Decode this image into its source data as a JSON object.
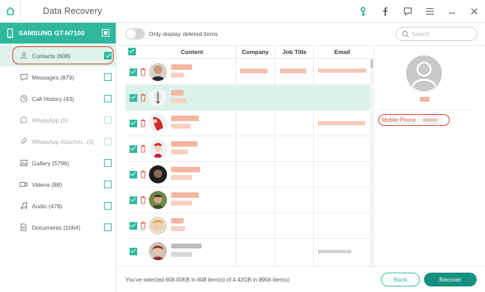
{
  "app": {
    "title": "Data Recovery"
  },
  "titlebar_icons": [
    "key-icon",
    "facebook-icon",
    "feedback-icon",
    "menu-icon",
    "minimize-icon",
    "close-icon"
  ],
  "device": {
    "name": "SAMSUNG GT-N7100"
  },
  "sidebar": {
    "items": [
      {
        "label": "Contacts (608)",
        "icon": "contact-icon",
        "active": true,
        "checked": true
      },
      {
        "label": "Messages (879)",
        "icon": "message-icon"
      },
      {
        "label": "Call History (43)",
        "icon": "clock-icon"
      },
      {
        "label": "WhatsApp (0)",
        "icon": "whatsapp-icon",
        "dim": true
      },
      {
        "label": "WhatsApp Attachm...(0)",
        "icon": "paperclip-icon",
        "dim": true
      },
      {
        "label": "Gallery (5796)",
        "icon": "image-icon"
      },
      {
        "label": "Videos (88)",
        "icon": "video-icon"
      },
      {
        "label": "Audio (478)",
        "icon": "music-icon"
      },
      {
        "label": "Documents (1064)",
        "icon": "document-icon"
      }
    ]
  },
  "toolbar": {
    "toggle_label": "Only display deleted items",
    "search_placeholder": "Search"
  },
  "table": {
    "headers": {
      "content": "Content",
      "company": "Company",
      "job_title": "Job Title",
      "email": "Email"
    }
  },
  "detail": {
    "field_label": "Mobile Phone"
  },
  "footer": {
    "selection_text": "You've selected 608.00KB in 608 item(s) of 4.42GB in 8956 item(s)",
    "back_label": "Back",
    "recover_label": "Recover"
  },
  "colors": {
    "accent": "#2fb89c",
    "accent_dark": "#16907f",
    "highlight": "#d0342c"
  }
}
